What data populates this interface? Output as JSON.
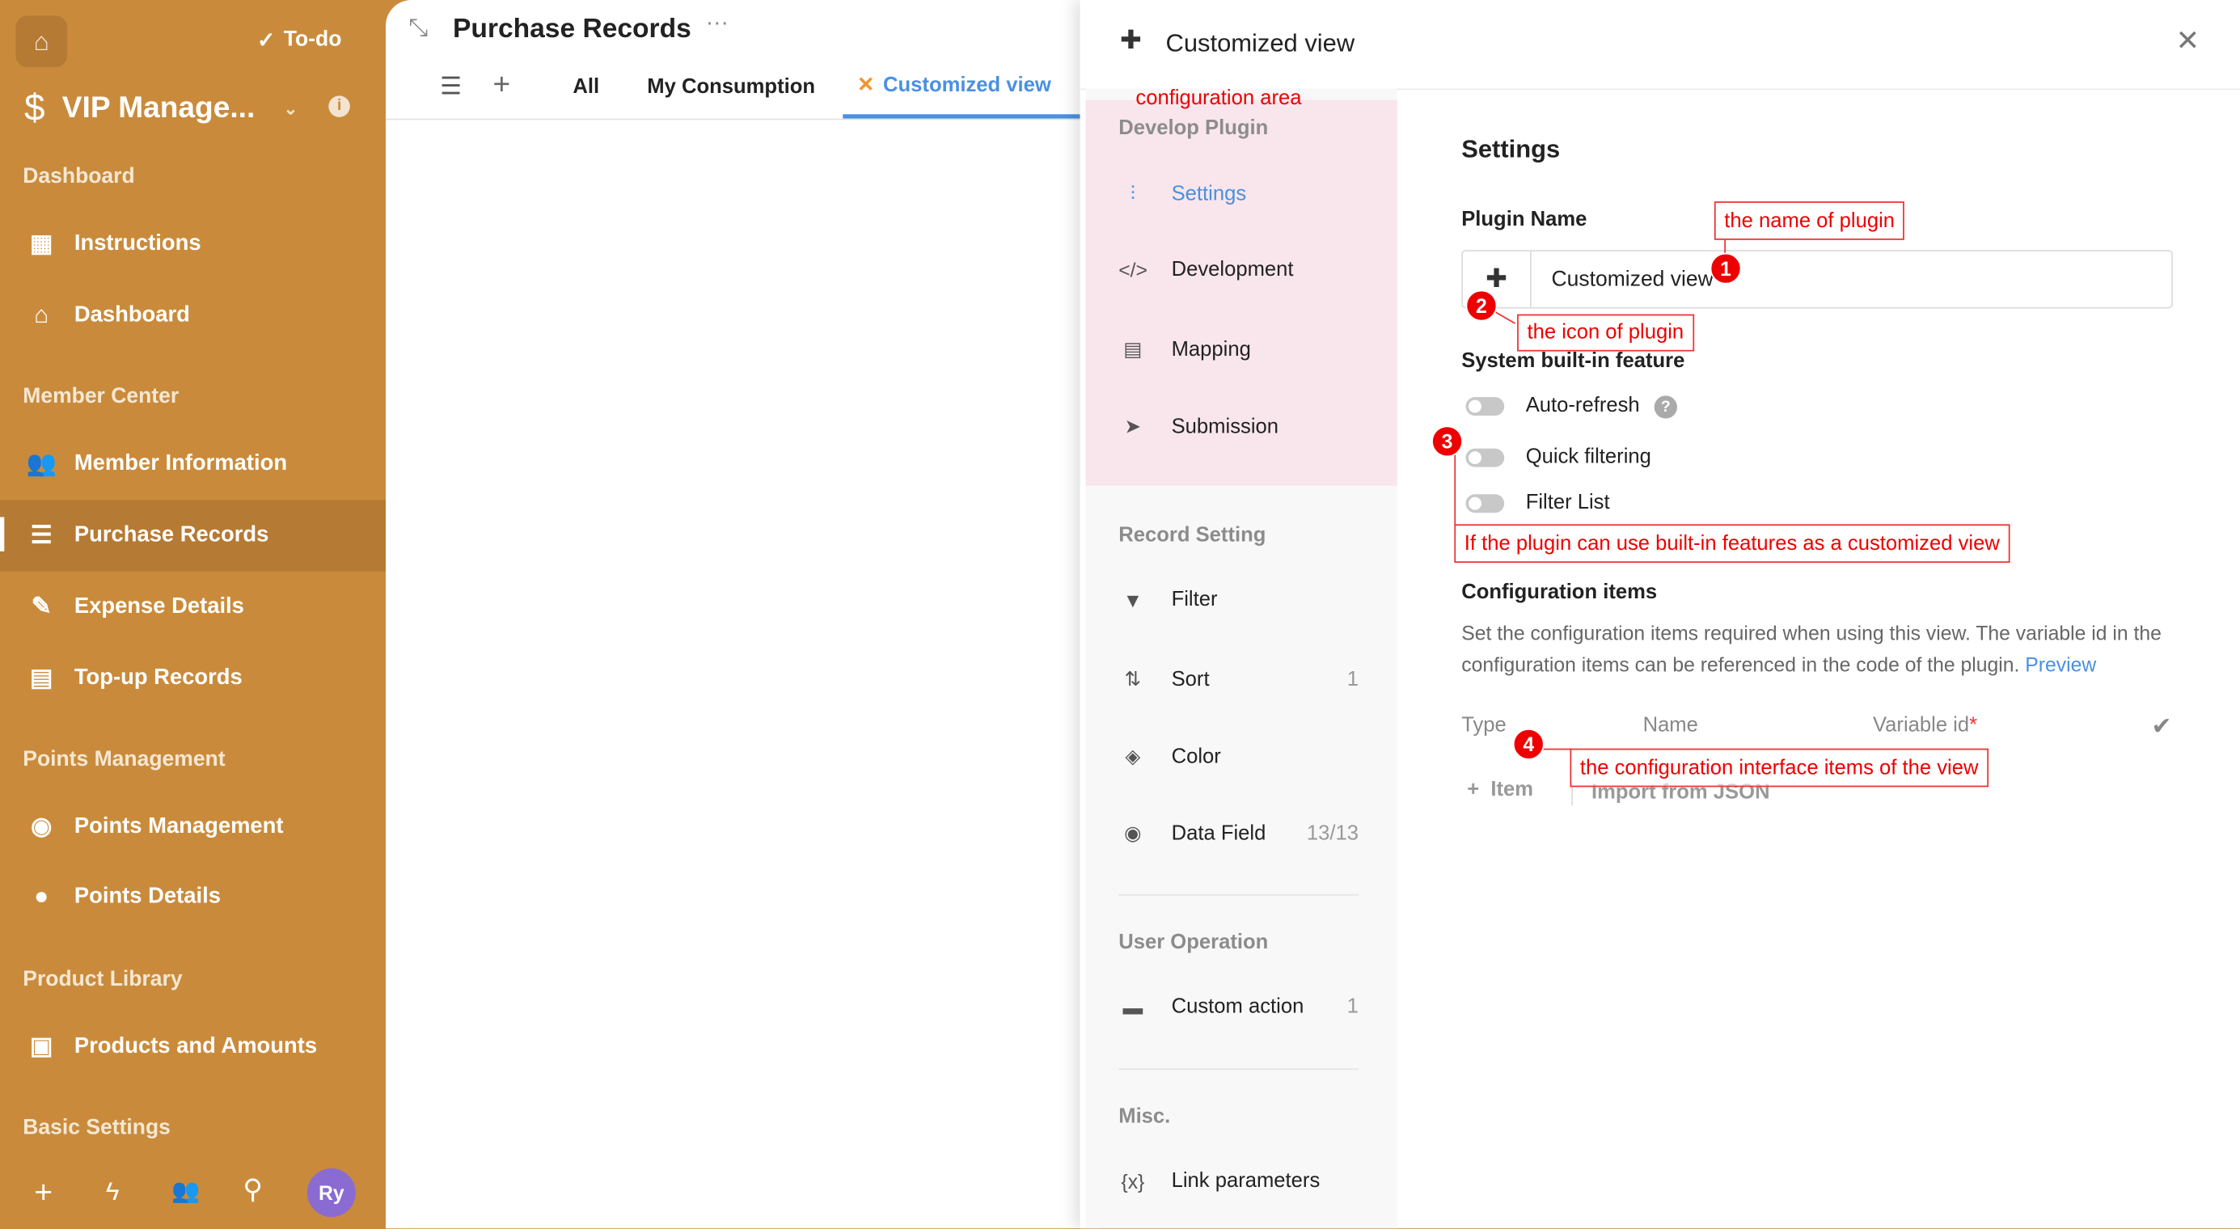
{
  "sidebar": {
    "todo": "To-do",
    "app_name": "VIP Manage...",
    "avatar": "Ry",
    "sections": {
      "dashboard": "Dashboard",
      "member_center": "Member Center",
      "points": "Points Management",
      "product": "Product Library",
      "basic": "Basic Settings"
    },
    "items": [
      {
        "label": "Instructions",
        "icon": "grid-icon"
      },
      {
        "label": "Dashboard",
        "icon": "house-icon"
      },
      {
        "label": "Member Information",
        "icon": "people-icon"
      },
      {
        "label": "Purchase Records",
        "icon": "list-icon",
        "active": true
      },
      {
        "label": "Expense Details",
        "icon": "edit-icon"
      },
      {
        "label": "Top-up Records",
        "icon": "wallet-icon"
      },
      {
        "label": "Points Management",
        "icon": "coin-icon"
      },
      {
        "label": "Points Details",
        "icon": "piggy-icon"
      },
      {
        "label": "Products and Amounts",
        "icon": "table-icon"
      }
    ]
  },
  "main": {
    "title": "Purchase Records",
    "tabs": [
      "All",
      "My Consumption",
      "Customized view"
    ],
    "active_tab": "Customized view"
  },
  "drawer": {
    "title": "Customized view",
    "nav": {
      "develop_plugin": "Develop Plugin",
      "settings": "Settings",
      "development": "Development",
      "mapping": "Mapping",
      "submission": "Submission",
      "record_setting": "Record Setting",
      "filter": "Filter",
      "sort": "Sort",
      "sort_count": "1",
      "color": "Color",
      "data_field": "Data Field",
      "data_field_count": "13/13",
      "user_operation": "User Operation",
      "custom_action": "Custom action",
      "custom_action_count": "1",
      "misc": "Misc.",
      "link_parameters": "Link parameters"
    },
    "content": {
      "heading": "Settings",
      "plugin_name_label": "Plugin Name",
      "plugin_name_value": "Customized view",
      "builtin_label": "System built-in feature",
      "auto_refresh": "Auto-refresh",
      "quick_filtering": "Quick filtering",
      "filter_list": "Filter List",
      "config_items": "Configuration items",
      "config_desc": "Set the configuration items required when using this view. The variable id in the configuration items can be referenced in the code of the plugin.",
      "preview": "Preview",
      "col_type": "Type",
      "col_name": "Name",
      "col_varid": "Variable id",
      "required": "*",
      "add_item": "Item",
      "import_json": "Import from JSON"
    }
  },
  "annotations": {
    "config_area": "configuration area",
    "n1": "1",
    "a1": "the name of plugin",
    "n2": "2",
    "a2": "the icon of plugin",
    "n3": "3",
    "a3": "If the plugin can use built-in features as a customized view",
    "n4": "4",
    "a4": "the configuration interface items of the view"
  },
  "colors": {
    "sidebar": "#c98b3b",
    "accent": "#4a90e2",
    "annotation": "#e00000"
  }
}
